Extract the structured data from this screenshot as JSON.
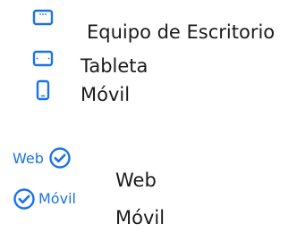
{
  "colors": {
    "accent": "#1a73e8",
    "text": "#1a1a1a"
  },
  "devices": [
    {
      "icon": "desktop-icon",
      "label": "Equipo de Escritorio"
    },
    {
      "icon": "tablet-icon",
      "label": "Tableta"
    },
    {
      "icon": "mobile-icon",
      "label": "Móvil"
    }
  ],
  "badges": [
    {
      "icon": "check-circle-icon",
      "badge": "Web",
      "label": "Web"
    },
    {
      "icon": "check-circle-icon",
      "badge": "Móvil",
      "label": "Móvil"
    }
  ]
}
